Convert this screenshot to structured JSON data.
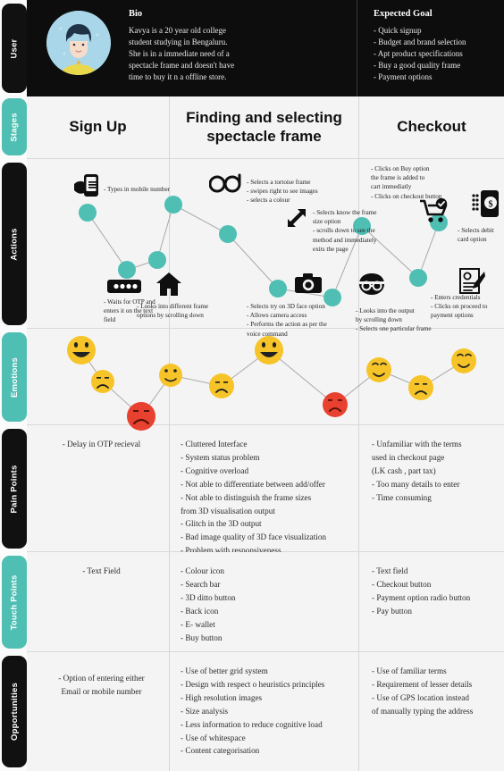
{
  "colors": {
    "teal": "#4fbfb4",
    "dark": "#111111",
    "happy": "#f6c428",
    "sad": "#e8412f",
    "panel": "#f4f4f4"
  },
  "rail": [
    {
      "label": "User",
      "style": "dark"
    },
    {
      "label": "Stages",
      "style": "teal"
    },
    {
      "label": "Actions",
      "style": "dark"
    },
    {
      "label": "Emotions",
      "style": "teal"
    },
    {
      "label": "Pain Points",
      "style": "dark"
    },
    {
      "label": "Touch Points",
      "style": "teal"
    },
    {
      "label": "Opportunities",
      "style": "dark"
    }
  ],
  "user": {
    "bio_title": "Bio",
    "bio_lines": [
      "Kavya is a 20 year old college",
      "student studying in Bengaluru.",
      "She is in a immediate need of a",
      "spectacle frame and doesn't have",
      "time to buy it n a offline store."
    ],
    "goal_title": "Expected Goal",
    "goal_lines": [
      "- Quick signup",
      "- Budget and brand selection",
      "- Apt product specifications",
      "- Buy a good quality frame",
      "- Payment options"
    ]
  },
  "stages": [
    {
      "label": "Sign Up"
    },
    {
      "label": "Finding and selecting\nspectacle frame"
    },
    {
      "label": "Checkout"
    }
  ],
  "actions": {
    "captions": [
      {
        "id": "types-mobile",
        "lines": [
          "- Types in mobile number"
        ]
      },
      {
        "id": "waits-otp",
        "lines": [
          "- Waits for OTP and",
          "  enters it on the text",
          "  field"
        ]
      },
      {
        "id": "browse-frames",
        "lines": [
          "- Looks into different frame",
          "  options by scrolling down"
        ]
      },
      {
        "id": "tortoise-frame",
        "lines": [
          "- Selects a tortoise frame",
          "- swipes right to see images",
          "- selects a colour"
        ]
      },
      {
        "id": "frame-size",
        "lines": [
          "- Selects know the frame",
          "  size option",
          "- scrolls down to see the",
          "  method and immediately",
          "  exits the page"
        ]
      },
      {
        "id": "try-on-3d",
        "lines": [
          "- Selects try on 3D face option",
          "- Allows camera access",
          "- Performs the action as per the",
          "  voice command"
        ]
      },
      {
        "id": "looks-output",
        "lines": [
          "- Looks into the output",
          "  by scrolling down",
          "- Selects one particular frame"
        ]
      },
      {
        "id": "buy-option",
        "lines": [
          "- Clicks on Buy option",
          "  the frame is added to",
          "  cart immediatly",
          "- Clicks on checkout button"
        ]
      },
      {
        "id": "credentials",
        "lines": [
          "- Enters credentials",
          "- Clicks on proceed to",
          "  payment options"
        ]
      },
      {
        "id": "debit-card",
        "lines": [
          "- Selects debit",
          "  card option"
        ]
      }
    ],
    "icons": [
      {
        "name": "hand-phone-icon"
      },
      {
        "name": "otp-dots-icon"
      },
      {
        "name": "home-icon"
      },
      {
        "name": "eyeglasses-icon"
      },
      {
        "name": "resize-arrows-icon"
      },
      {
        "name": "camera-icon"
      },
      {
        "name": "face-glasses-icon"
      },
      {
        "name": "cart-check-icon"
      },
      {
        "name": "form-pen-icon"
      },
      {
        "name": "mobile-payment-icon"
      }
    ]
  },
  "emotions": {
    "points": [
      {
        "mood": "happy"
      },
      {
        "mood": "sad-yellow"
      },
      {
        "mood": "angry-red"
      },
      {
        "mood": "neutral"
      },
      {
        "mood": "sad-yellow"
      },
      {
        "mood": "happy"
      },
      {
        "mood": "angry-red"
      },
      {
        "mood": "smile"
      },
      {
        "mood": "sad-yellow"
      },
      {
        "mood": "smile"
      }
    ]
  },
  "pain_points": {
    "signup": [
      "- Delay in OTP recieval"
    ],
    "finding": [
      "- Cluttered Interface",
      "- System status problem",
      "- Cognitive overload",
      "- Not able to differentiate between add/offer",
      "- Not able to distinguish the frame sizes",
      "   from 3D visualisation output",
      "- Glitch in the 3D output",
      "- Bad image quality of 3D face visualization",
      "- Problem with responsiveness"
    ],
    "checkout": [
      "- Unfamiliar with the terms",
      "   used in checkout page",
      "   (LK cash , part tax)",
      "- Too many details to enter",
      "- Time consuming"
    ]
  },
  "touch_points": {
    "signup": [
      "- Text Field"
    ],
    "finding": [
      "- Colour icon",
      "- Search bar",
      "- 3D ditto button",
      "- Back icon",
      "- E- wallet",
      "- Buy button"
    ],
    "checkout": [
      "- Text field",
      "- Checkout button",
      "- Payment option radio button",
      "- Pay button"
    ]
  },
  "opportunities": {
    "signup": [
      "- Option of entering either",
      "   Email or mobile number"
    ],
    "finding": [
      "- Use of better grid system",
      "- Design with respect o heuristics principles",
      "- High resolution images",
      "- Size analysis",
      "- Less information to reduce cognitive load",
      "- Use of whitespace",
      "- Content categorisation"
    ],
    "checkout": [
      "- Use of familiar terms",
      "- Requirement of lesser details",
      "- Use of GPS location instead",
      "   of manually typing the address"
    ]
  }
}
